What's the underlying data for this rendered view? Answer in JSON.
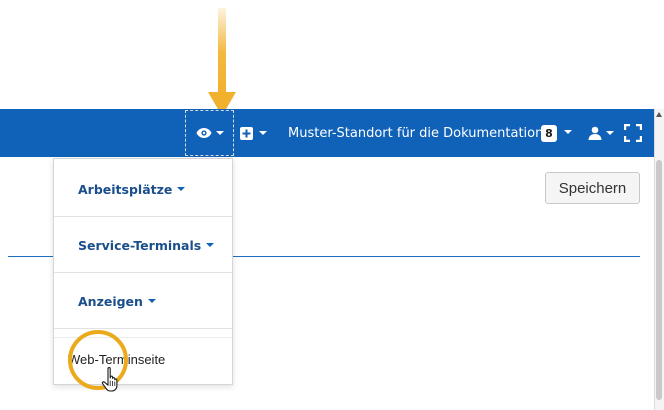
{
  "navbar": {
    "location_label": "Muster-Standort für die Dokumentation",
    "badge_count": "8"
  },
  "page": {
    "save_label": "Speichern"
  },
  "dropdown": {
    "items": [
      {
        "label": "Arbeitsplätze"
      },
      {
        "label": "Service-Terminals"
      },
      {
        "label": "Anzeigen"
      }
    ],
    "link_label": "Web-Terminseite"
  },
  "icons": {
    "view": "eye-icon",
    "add": "plus-square-icon",
    "user": "user-icon",
    "fullscreen": "fullscreen-icon",
    "pointer": "hand-pointer-icon",
    "callout": "down-arrow-icon"
  },
  "colors": {
    "navbar": "#1062b8",
    "accent_arrow": "#f2b12c",
    "highlight": "#eba91c",
    "menu_text": "#1a4f8b"
  }
}
